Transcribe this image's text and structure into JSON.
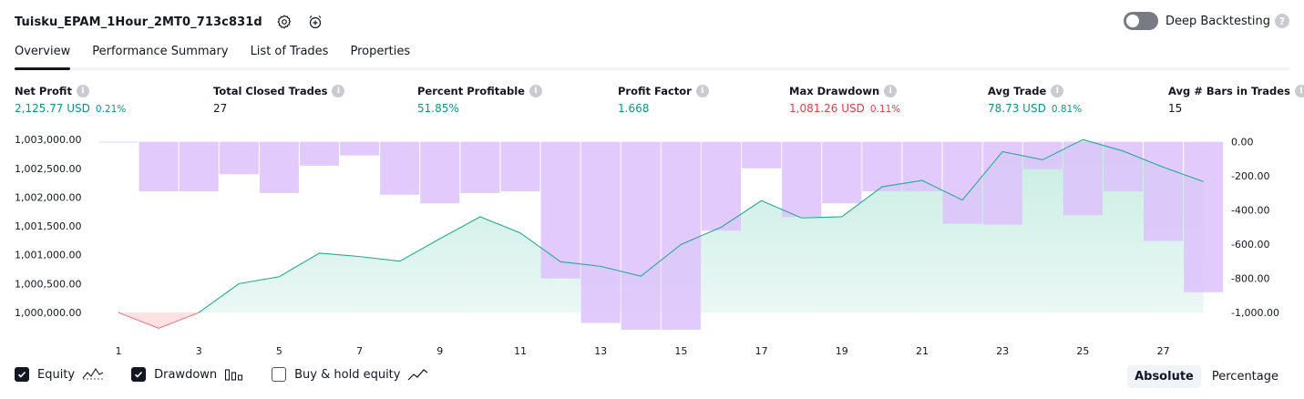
{
  "header": {
    "title": "Tuisku_EPAM_1Hour_2MT0_713c831d",
    "deep_backtesting_label": "Deep Backtesting"
  },
  "tabs": [
    {
      "label": "Overview",
      "active": true
    },
    {
      "label": "Performance Summary",
      "active": false
    },
    {
      "label": "List of Trades",
      "active": false
    },
    {
      "label": "Properties",
      "active": false
    }
  ],
  "metrics": [
    {
      "label": "Net Profit",
      "value": "2,125.77 USD",
      "pct": "0.21%",
      "color": "green"
    },
    {
      "label": "Total Closed Trades",
      "value": "27",
      "pct": "",
      "color": "dark"
    },
    {
      "label": "Percent Profitable",
      "value": "51.85%",
      "pct": "",
      "color": "green"
    },
    {
      "label": "Profit Factor",
      "value": "1.668",
      "pct": "",
      "color": "green"
    },
    {
      "label": "Max Drawdown",
      "value": "1,081.26 USD",
      "pct": "0.11%",
      "color": "red"
    },
    {
      "label": "Avg Trade",
      "value": "78.73 USD",
      "pct": "0.81%",
      "color": "green"
    },
    {
      "label": "Avg # Bars in Trades",
      "value": "15",
      "pct": "",
      "color": "dark"
    }
  ],
  "chart_data": {
    "type": "line",
    "x_ticks": [
      "1",
      "3",
      "5",
      "7",
      "9",
      "11",
      "13",
      "15",
      "17",
      "19",
      "21",
      "23",
      "25",
      "27"
    ],
    "left_axis": {
      "ticks": [
        "1,003,000.00",
        "1,002,500.00",
        "1,002,000.00",
        "1,001,500.00",
        "1,001,000.00",
        "1,000,500.00",
        "1,000,000.00"
      ],
      "range": [
        999700,
        1003050
      ]
    },
    "right_axis": {
      "ticks": [
        "0.00",
        "-200.00",
        "-400.00",
        "-600.00",
        "-800.00",
        "-1,000.00"
      ],
      "range": [
        -1100,
        30
      ]
    },
    "baseline": 1000000,
    "equity_series": {
      "name": "Equity",
      "x": [
        1,
        2,
        3,
        4,
        5,
        6,
        7,
        8,
        9,
        10,
        11,
        12,
        13,
        14,
        15,
        16,
        17,
        18,
        19,
        20,
        21,
        22,
        23,
        24,
        25,
        26,
        27,
        28
      ],
      "values": [
        1000000,
        999730,
        1000000,
        1000500,
        1000620,
        1001030,
        1000970,
        1000890,
        1001280,
        1001660,
        1001380,
        1000880,
        1000800,
        1000630,
        1001180,
        1001480,
        1001940,
        1001640,
        1001660,
        1002180,
        1002290,
        1001950,
        1002790,
        1002650,
        1003000,
        1002800,
        1002520,
        1002270
      ]
    },
    "drawdown_series": {
      "name": "Drawdown",
      "x": [
        1,
        2,
        3,
        4,
        5,
        6,
        7,
        8,
        9,
        10,
        11,
        12,
        13,
        14,
        15,
        16,
        17,
        18,
        19,
        20,
        21,
        22,
        23,
        24,
        25,
        26,
        27,
        28
      ],
      "values": [
        0,
        -290,
        -290,
        -190,
        -300,
        -140,
        -80,
        -310,
        -360,
        -300,
        -290,
        -800,
        -1060,
        -1100,
        -1100,
        -520,
        -155,
        -440,
        -360,
        -290,
        -290,
        -480,
        -485,
        -160,
        -430,
        -290,
        -580,
        -880
      ]
    },
    "colors": {
      "equity_line": "#22ab94",
      "equity_fill": "#cdeee6",
      "below_line": "#f23645",
      "drawdown_fill": "#ddc2fb"
    }
  },
  "legend": {
    "items": [
      {
        "label": "Equity",
        "checked": true,
        "icon": "equity-line-icon"
      },
      {
        "label": "Drawdown",
        "checked": true,
        "icon": "drawdown-bars-icon"
      },
      {
        "label": "Buy & hold equity",
        "checked": false,
        "icon": "buyhold-line-icon"
      }
    ],
    "modes": [
      {
        "label": "Absolute",
        "active": true
      },
      {
        "label": "Percentage",
        "active": false
      }
    ]
  }
}
